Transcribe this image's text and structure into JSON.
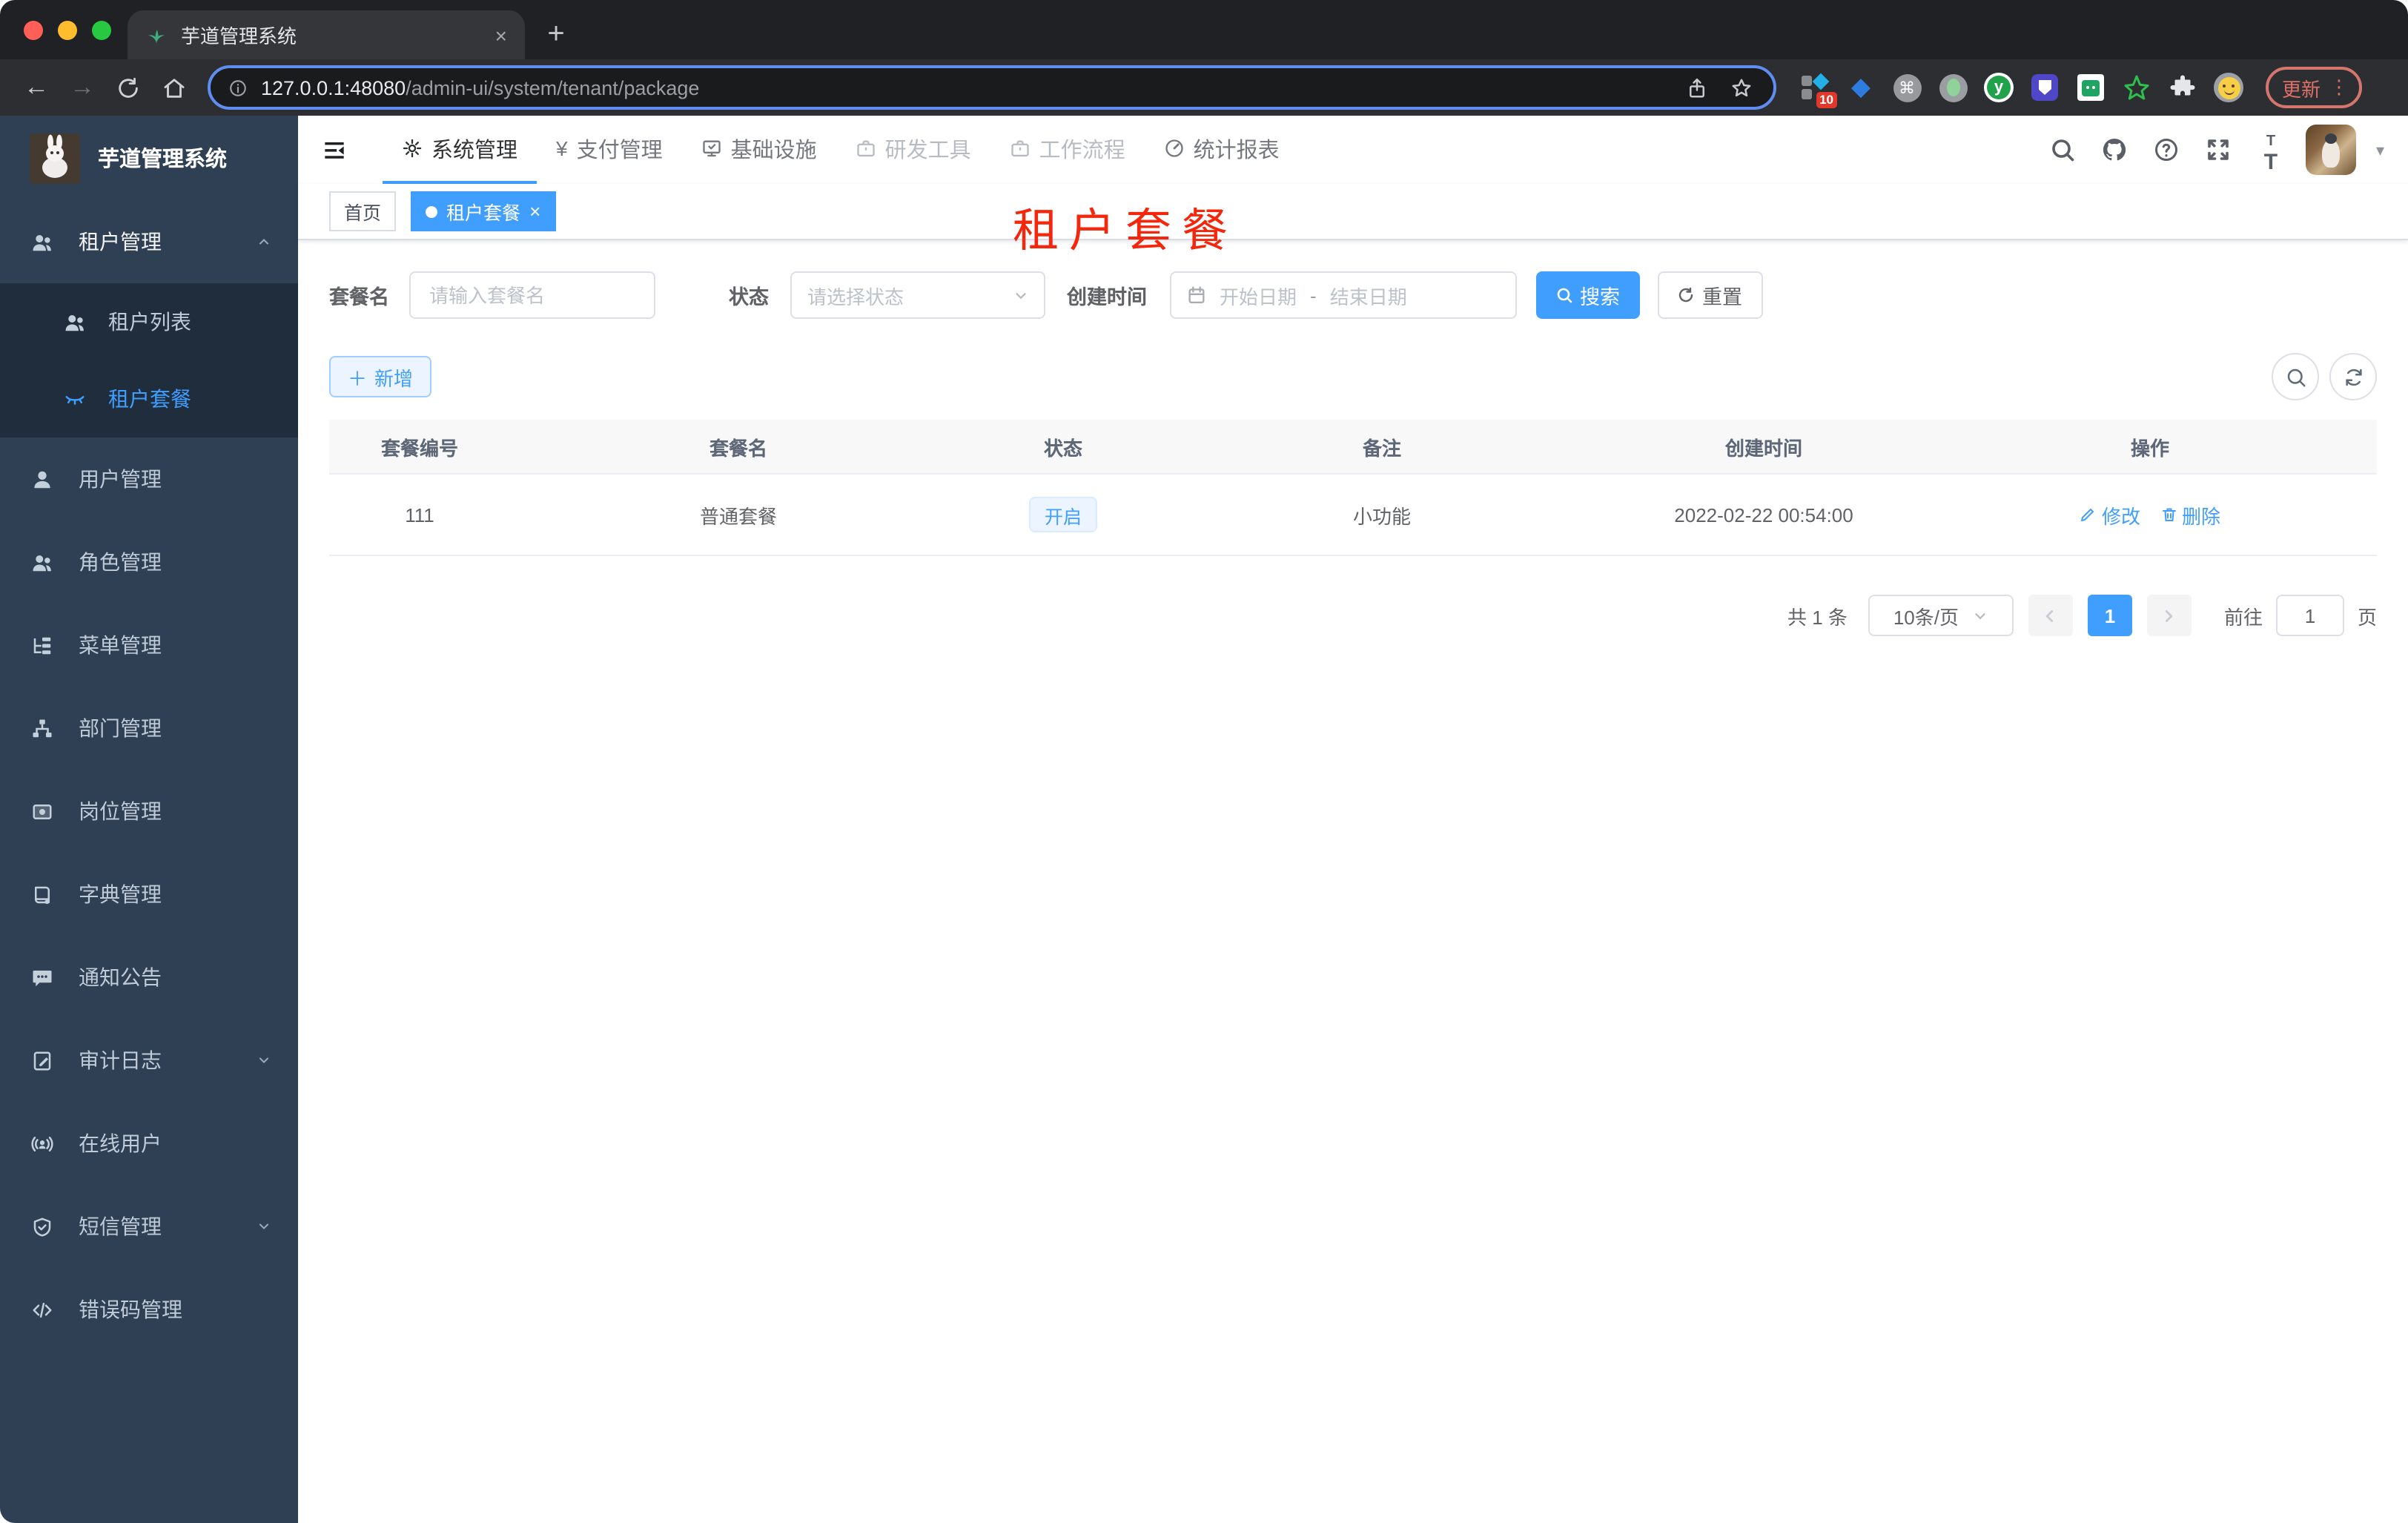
{
  "browser": {
    "tab_title": "芋道管理系统",
    "url_host": "127.0.0.1:48080",
    "url_path": "/admin-ui/system/tenant/package",
    "extension_badge": "10",
    "update_label": "更新"
  },
  "sidebar": {
    "logo_title": "芋道管理系统",
    "items": [
      {
        "label": "租户管理",
        "icon": "peoples-icon",
        "state": "expanded"
      },
      {
        "label": "租户列表",
        "icon": "peoples-icon"
      },
      {
        "label": "租户套餐",
        "icon": "eye-close-icon",
        "active": true
      },
      {
        "label": "用户管理",
        "icon": "user-icon"
      },
      {
        "label": "角色管理",
        "icon": "peoples-icon"
      },
      {
        "label": "菜单管理",
        "icon": "tree-table-icon"
      },
      {
        "label": "部门管理",
        "icon": "org-tree-icon"
      },
      {
        "label": "岗位管理",
        "icon": "post-icon"
      },
      {
        "label": "字典管理",
        "icon": "dict-icon"
      },
      {
        "label": "通知公告",
        "icon": "message-icon"
      },
      {
        "label": "审计日志",
        "icon": "log-icon",
        "state": "collapsed"
      },
      {
        "label": "在线用户",
        "icon": "online-user-icon"
      },
      {
        "label": "短信管理",
        "icon": "shield-icon",
        "state": "collapsed"
      },
      {
        "label": "错误码管理",
        "icon": "code-icon"
      }
    ]
  },
  "topnav": {
    "items": [
      {
        "label": "系统管理",
        "icon": "gear-icon",
        "active": true
      },
      {
        "label": "支付管理",
        "icon": "yen-icon"
      },
      {
        "label": "基础设施",
        "icon": "monitor-icon"
      },
      {
        "label": "研发工具",
        "icon": "briefcase-icon"
      },
      {
        "label": "工作流程",
        "icon": "briefcase-icon"
      },
      {
        "label": "统计报表",
        "icon": "dashboard-icon"
      }
    ]
  },
  "tags": {
    "home": "首页",
    "active": "租户套餐"
  },
  "overlay_title": "租户套餐",
  "filters": {
    "name_label": "套餐名",
    "name_placeholder": "请输入套餐名",
    "status_label": "状态",
    "status_placeholder": "请选择状态",
    "date_label": "创建时间",
    "date_start_placeholder": "开始日期",
    "date_separator": "-",
    "date_end_placeholder": "结束日期",
    "search_label": "搜索",
    "reset_label": "重置"
  },
  "toolbar": {
    "add_label": "新增"
  },
  "table": {
    "headers": [
      "套餐编号",
      "套餐名",
      "状态",
      "备注",
      "创建时间",
      "操作"
    ],
    "rows": [
      {
        "package_id": "111",
        "name": "普通套餐",
        "status": "开启",
        "remark": "小功能",
        "create_time": "2022-02-22 00:54:00",
        "action_edit": "修改",
        "action_delete": "删除"
      }
    ]
  },
  "pagination": {
    "total": "共 1 条",
    "page_size": "10条/页",
    "current_page": "1",
    "goto_label": "前往",
    "goto_value": "1",
    "unit_label": "页"
  },
  "colors": {
    "accent": "#409eff",
    "sidebar_bg": "#2f3f54",
    "submenu_bg": "#1f2d3d",
    "overlay_red": "#f4260b",
    "status_tag_bg": "#ecf5ff",
    "favicon_green": "#3eaf7c"
  }
}
